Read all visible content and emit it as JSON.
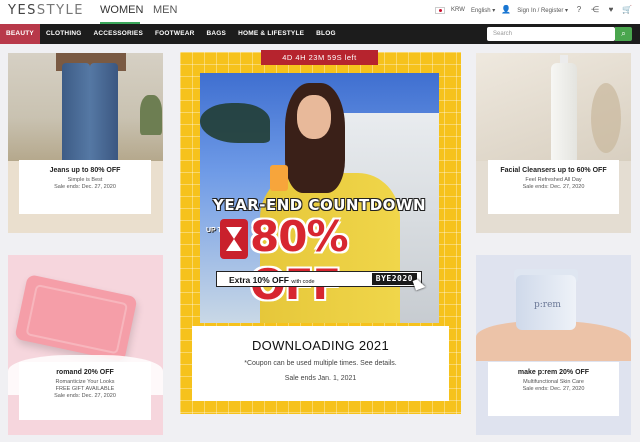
{
  "header": {
    "logo_yes": "YES",
    "logo_style": "STYLE",
    "tabs": [
      {
        "label": "WOMEN",
        "active": true
      },
      {
        "label": "MEN",
        "active": false
      }
    ],
    "currency": "KRW",
    "language": "English ▾",
    "account": "Sign In / Register ▾",
    "icons": [
      "help-icon",
      "share-icon",
      "wishlist-heart-icon",
      "cart-icon"
    ]
  },
  "nav": {
    "categories": [
      "BEAUTY",
      "CLOTHING",
      "ACCESSORIES",
      "FOOTWEAR",
      "BAGS",
      "HOME & LIFESTYLE",
      "BLOG"
    ],
    "active": "BEAUTY",
    "search_placeholder": "Search"
  },
  "cards": {
    "jeans": {
      "title": "Jeans up to 80% OFF",
      "line1": "Simple is Best",
      "line2": "Sale ends: Dec. 27, 2020"
    },
    "romand": {
      "title": "romand 20% OFF",
      "line1": "Romanticize Your Looks",
      "line2": "FREE GIFT AVAILABLE",
      "line3": "Sale ends: Dec. 27, 2020"
    },
    "facial": {
      "title": "Facial Cleansers up to 60% OFF",
      "line1": "Feel Refreshed All Day",
      "line2": "Sale ends: Dec. 27, 2020"
    },
    "prem": {
      "title": "make p:rem 20% OFF",
      "line1": "Multifunctional Skin Care",
      "line2": "Sale ends: Dec. 27, 2020",
      "jar_brand": "p:rem"
    }
  },
  "promo": {
    "timer": "4D 4H 23M 59S left",
    "headline": "YEAR-END COUNTDOWN",
    "up_to": "UP TO",
    "discount": "80% OFF",
    "extra": "Extra 10% OFF",
    "with_code": "with code",
    "code": "BYE2020",
    "caption_title": "DOWNLOADING 2021",
    "caption_line1": "*Coupon can be used multiple times. See details.",
    "caption_line2": "Sale ends Jan. 1, 2021"
  },
  "colors": {
    "accent_green": "#3aa65a",
    "nav_bg": "#1c1c1c",
    "beauty_active": "#b8394a",
    "promo_yellow": "#f6c21c",
    "promo_red": "#d72630"
  }
}
